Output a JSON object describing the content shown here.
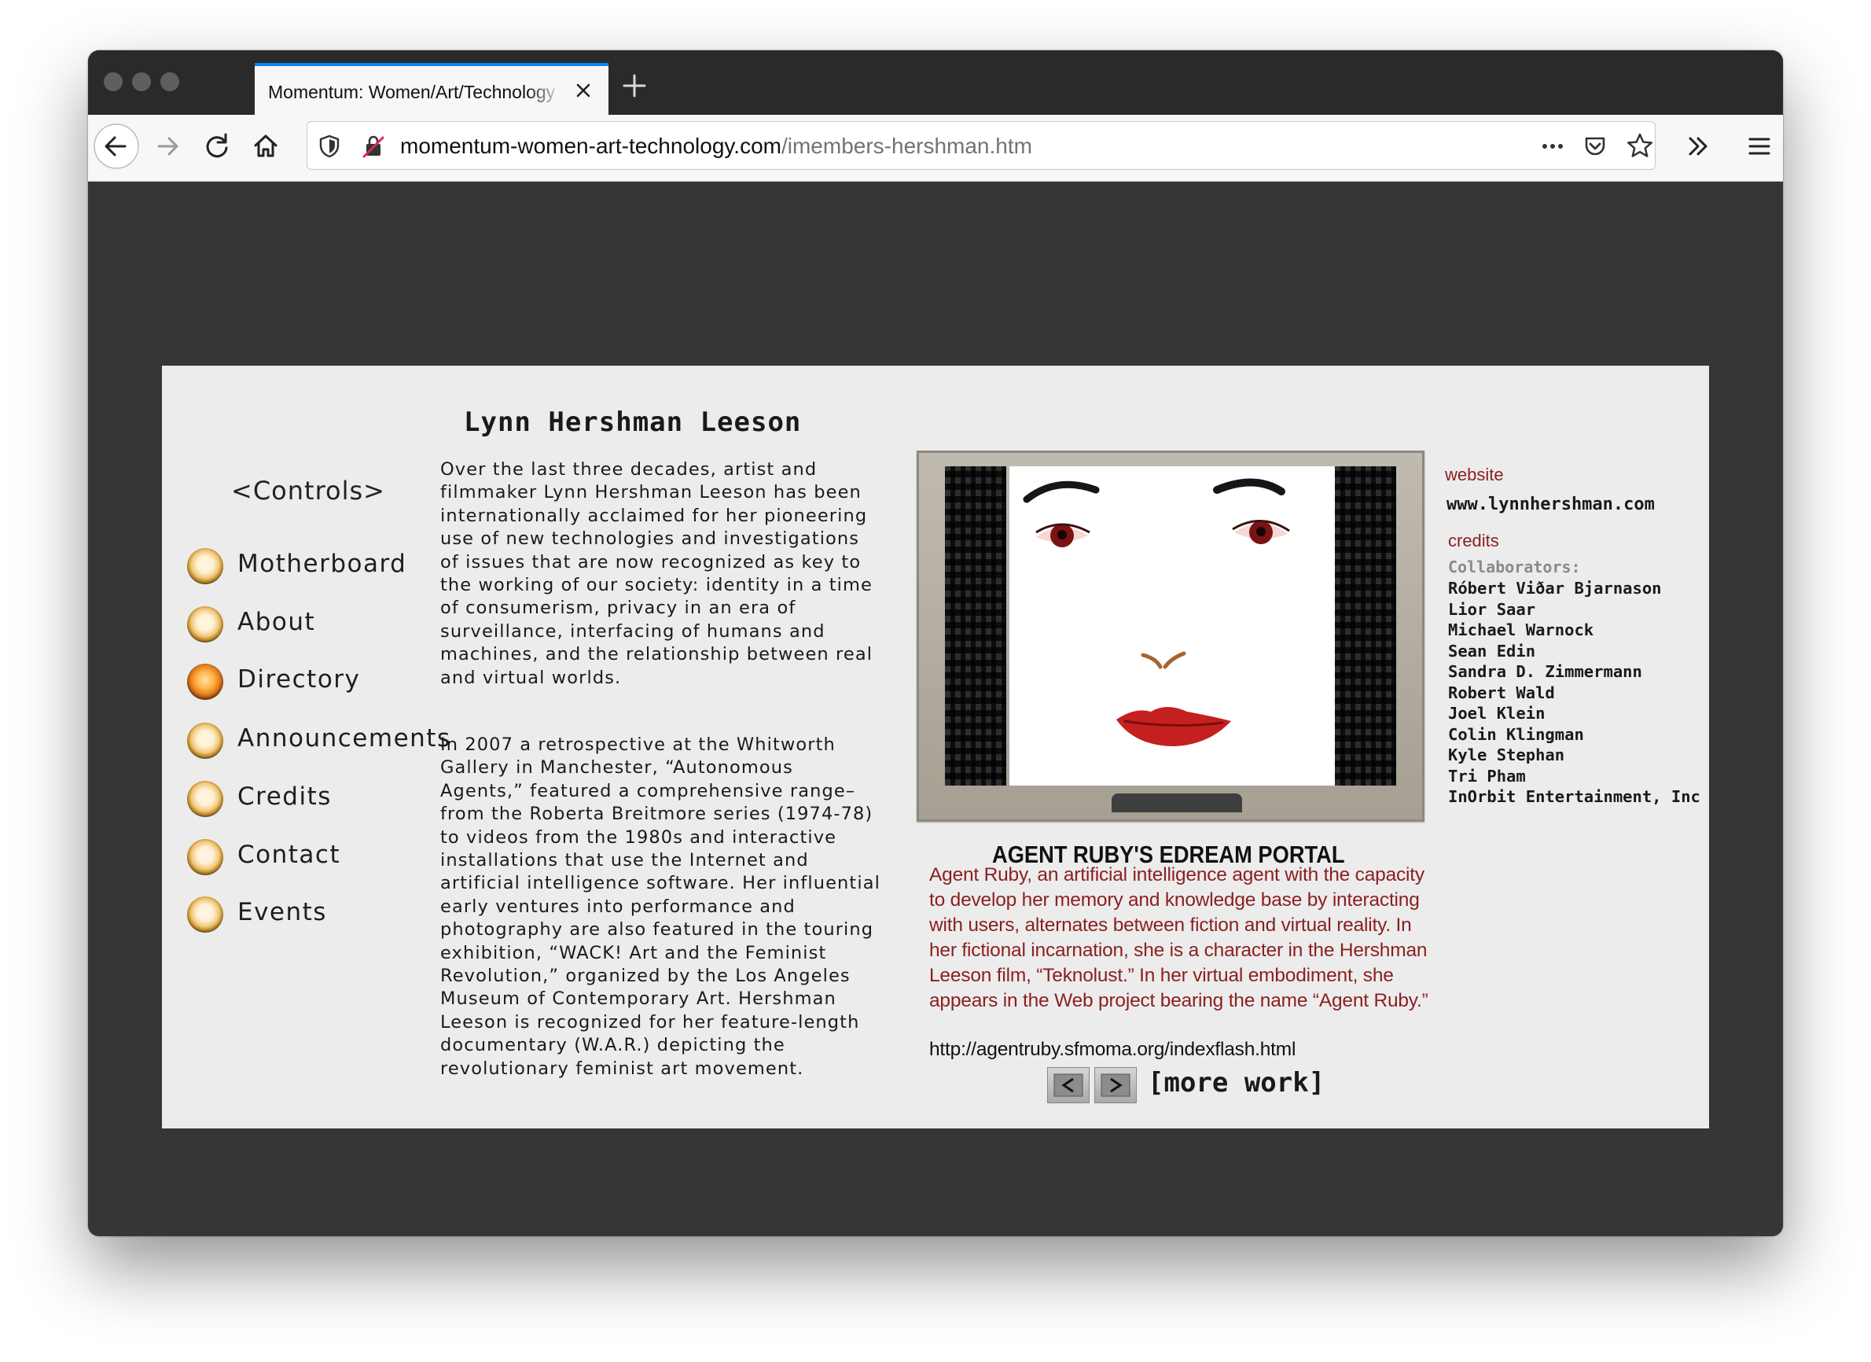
{
  "browser": {
    "tab_title": "Momentum: Women/Art/Technology",
    "url_domain": "momentum-women-art-technology.com",
    "url_path": "/imembers-hershman.htm"
  },
  "sidebar": {
    "title": "<Controls>",
    "items": [
      {
        "label": "Motherboard"
      },
      {
        "label": "About"
      },
      {
        "label": "Directory"
      },
      {
        "label": "Announcements"
      },
      {
        "label": "Credits"
      },
      {
        "label": "Contact"
      },
      {
        "label": "Events"
      }
    ]
  },
  "artist": {
    "name": "Lynn Hershman Leeson",
    "bio_paragraph_1": "Over the last three decades, artist and filmmaker Lynn Hershman Leeson has been internationally acclaimed for her pioneering use of new technologies and investigations of issues that are now recognized as key to the working of our society: identity in a time of consumerism, privacy in an era of surveillance, interfacing of humans and machines, and the relationship between real and virtual worlds.",
    "bio_paragraph_2": "In 2007 a retrospective at the Whitworth Gallery in Manchester, “Autonomous Agents,” featured a comprehensive range–from the Roberta Breitmore series (1974-78) to videos from the 1980s and interactive installations that use the Internet and artificial intelligence software. Her influential early ventures into performance and photography are also featured in the touring exhibition, “WACK! Art and the Feminist Revolution,” organized by the Los Angeles Museum of Contemporary Art. Hershman Leeson is recognized for her feature-length documentary (W.A.R.) depicting the revolutionary feminist art movement."
  },
  "work": {
    "title": "AGENT RUBY'S EDREAM PORTAL",
    "description": "Agent Ruby, an artificial intelligence agent with the capacity to develop her memory and knowledge base by interacting with users, alternates between fiction and virtual reality. In her fictional incarnation, she is a character in the Hershman Leeson film, “Teknolust.” In her virtual embodiment, she appears in the Web project bearing the name “Agent Ruby.”",
    "url": "http://agentruby.sfmoma.org/indexflash.html",
    "prev_label": "<",
    "next_label": ">",
    "more_work_label": "[more work]"
  },
  "side": {
    "website_label": "website",
    "website_url": "www.lynnhershman.com",
    "credits_label": "credits",
    "collaborators_heading": "Collaborators:",
    "collaborators": [
      "Róbert Viðar Bjarnason",
      "Lior Saar",
      "Michael Warnock",
      "Sean Edin",
      "Sandra D. Zimmermann",
      "Robert Wald",
      "Joel Klein",
      "Colin Klingman",
      "Kyle Stephan",
      "Tri Pham",
      "InOrbit Entertainment, Inc"
    ]
  },
  "icons": {
    "back": "arrow-left-icon",
    "forward": "arrow-right-icon",
    "reload": "reload-icon",
    "home": "home-icon",
    "shield": "tracking-protection-icon",
    "insecure": "insecure-lock-icon",
    "more": "ellipsis-icon",
    "pocket": "pocket-icon",
    "bookmark": "star-icon",
    "overflow": "chevrons-right-icon",
    "menu": "hamburger-menu-icon"
  },
  "colors": {
    "accent_tab": "#0a84ff",
    "text_red": "#8b1f1f",
    "page_bg": "#363636",
    "panel_bg": "#ececec"
  }
}
